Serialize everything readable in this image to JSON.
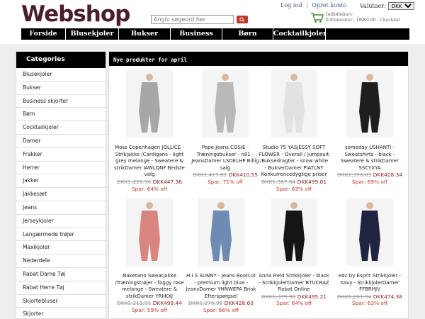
{
  "logo": "Webshop",
  "search": {
    "placeholder": "Angiv søgeord her"
  },
  "toplinks": {
    "login": "Log ind",
    "separator": "|",
    "register": "Opret konto"
  },
  "currency": {
    "label": "Valutaer:",
    "selected": "DKK"
  },
  "cart": {
    "title": "Indkøbskurv",
    "summary": "0 Elementer - DKK0.00 - Checkout"
  },
  "nav": [
    "Forside",
    "Blusekjoler",
    "Bukser",
    "Business",
    "Børn",
    "Cocktailkjoler"
  ],
  "sidebar": {
    "title": "Categories",
    "items": [
      "Blusekjoler",
      "Bukser",
      "Business skjorter",
      "Børn",
      "Cocktailkjoler",
      "Damer",
      "Frakker",
      "Herrer",
      "Jakker",
      "Jakkesæt",
      "Jeans",
      "Jerseykjoler",
      "Langærmede trøjer",
      "Maxikjoler",
      "Nederdele",
      "Rabat Dame Tøj",
      "Rabat Herre Tøj",
      "Skjortebluser",
      "Skjorter"
    ]
  },
  "main": {
    "title": "Nye produkter for april",
    "products": [
      {
        "name": "Moss Copenhagen JOLLICE - Strikjakke /Cardigans - light grey melange - Sweatere & strikDamer IAWLQNF Bedste valg",
        "old_price": "DKK1,225.96",
        "new_price": "DKK447.36",
        "save": "Spar: 64% off",
        "color": "#a7a7a7"
      },
      {
        "name": "Pepe Jeans COSIE - Træningsbukser - n81 - JeansDamer LSDELHP Billig salg",
        "old_price": "DKK1,417.82",
        "new_price": "DKK410.55",
        "save": "Spar: 71% off",
        "color": "#b9b9b9"
      },
      {
        "name": "Studio 75 YASJESSY SOFT FLOWER - Overall / Jumpsuit /Buksedragter - snow white - BukserDamer PIATLNY Konkurrencedygtige priser",
        "old_price": "DKK1,367.84",
        "new_price": "DKK499.81",
        "save": "Spar: 63% off",
        "color": "#e2e2e2"
      },
      {
        "name": "someday USHANTI - Sweatshirts - black - Sweatere & strikDamer SSCYXYA",
        "old_price": "DKK1,376.83",
        "new_price": "DKK428.34",
        "save": "Spar: 69% off",
        "color": "#1e1e1e"
      },
      {
        "name": "Naketano Sweatjakke /Træningstrøjer - foggy rose melange - Sweatere & strikDamer YRIIKXJ",
        "old_price": "DKK1,211.91",
        "new_price": "DKK499.44",
        "save": "Spar: 59% off",
        "color": "#d9857f"
      },
      {
        "name": "H.I.S SUNNY - Jeans Bootcut - premium light blue - JeansDamer YHNWEPA Brisk Efterspørgsel",
        "old_price": "DKK1,270.95",
        "new_price": "DKK428.60",
        "save": "Spar: 66% off",
        "color": "#6d8bb3"
      },
      {
        "name": "Anna Field Strikkjoler - black - StrikkjolerDamer BTUCRAZ Rabat Online",
        "old_price": "DKK1,375.98",
        "new_price": "DKK495.21",
        "save": "Spar: 64% off",
        "color": "#151515"
      },
      {
        "name": "edc by Esprit Strikkjoler - navy - StrikkjolerDamer FFBRHJV",
        "old_price": "DKK1,281.94",
        "new_price": "DKK474.38",
        "save": "Spar: 63% off",
        "color": "#1f2540"
      }
    ]
  }
}
